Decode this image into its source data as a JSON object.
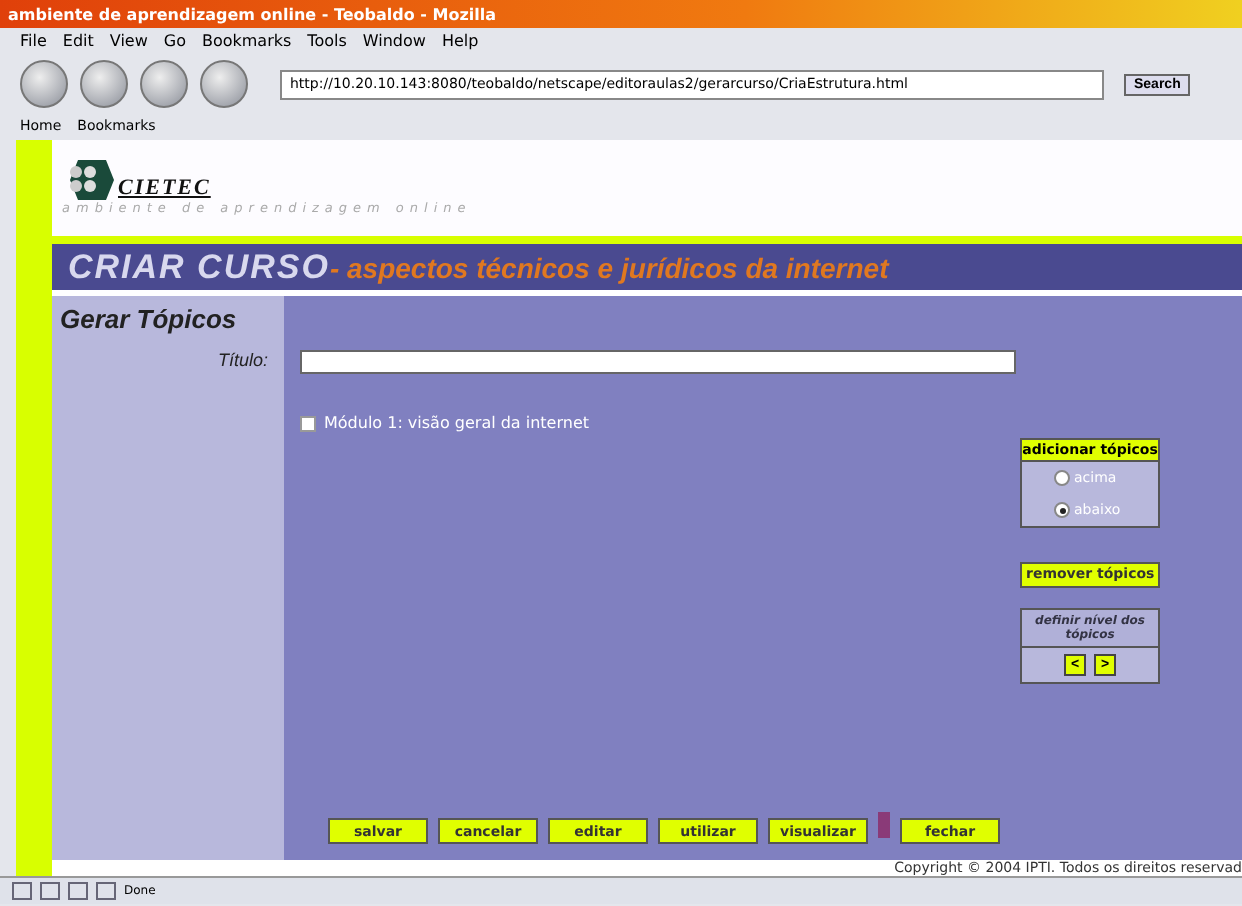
{
  "window": {
    "title": "ambiente de aprendizagem online - Teobaldo - Mozilla"
  },
  "menu": [
    "File",
    "Edit",
    "View",
    "Go",
    "Bookmarks",
    "Tools",
    "Window",
    "Help"
  ],
  "toolbar": {
    "url": "http://10.20.10.143:8080/teobaldo/netscape/editoraulas2/gerarcurso/CriaEstrutura.html",
    "search": "Search"
  },
  "bookmarks": [
    "Home",
    "Bookmarks"
  ],
  "header": {
    "logo": "CIETEC",
    "tagline": "ambiente de aprendizagem online",
    "title": "CRIAR CURSO",
    "subtitle": "- aspectos técnicos e jurídicos da internet"
  },
  "form": {
    "heading": "Gerar Tópicos",
    "title_label": "Título:",
    "topics": [
      {
        "label": "Módulo 1: visão geral da internet",
        "checked": false
      }
    ]
  },
  "add_panel": {
    "title": "adicionar tópicos",
    "options": [
      {
        "label": "acima",
        "selected": false
      },
      {
        "label": "abaixo",
        "selected": true
      }
    ]
  },
  "remove_button": "remover tópicos",
  "level_panel": {
    "title": "definir nível dos tópicos",
    "buttons": [
      "<",
      ">"
    ]
  },
  "actions": [
    {
      "label": "salvar",
      "marked": false
    },
    {
      "label": "cancelar",
      "marked": false
    },
    {
      "label": "editar",
      "marked": false
    },
    {
      "label": "utilizar",
      "marked": false
    },
    {
      "label": "visualizar",
      "marked": false
    },
    {
      "label": "fechar",
      "marked": true
    }
  ],
  "footer": "Copyright © 2004 IPTI. Todos os direitos reservad",
  "status_bar": {
    "text": "Done"
  }
}
